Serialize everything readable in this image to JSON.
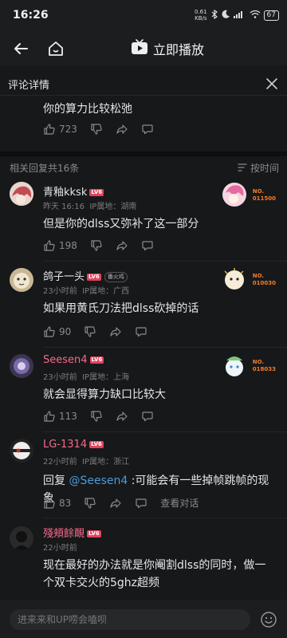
{
  "status": {
    "time": "16:26",
    "net_speed_value": "0.61",
    "net_speed_unit": "KB/s",
    "battery": "67"
  },
  "topbar": {
    "play_label": "立即播放"
  },
  "detail": {
    "title": "评论详情"
  },
  "main_comment": {
    "text": "你的算力比较松弛",
    "likes": "723"
  },
  "reply_section": {
    "count_label": "相关回复共16条",
    "sort_label": "按时间"
  },
  "replies": [
    {
      "username": "青釉kksk",
      "level": "LV6",
      "time": "昨天 16:16",
      "ip": "IP属地：湖南",
      "text": "但是你的dlss又弥补了这一部分",
      "likes": "198",
      "fan_no": "011500",
      "name_color": "#e6e6e6"
    },
    {
      "username": "鸽子一头",
      "level": "LV6",
      "tag": "番火鸡",
      "time": "23小时前",
      "ip": "IP属地：广西",
      "text": "如果用黄氏刀法把dlss砍掉的话",
      "likes": "90",
      "fan_no": "010030",
      "name_color": "#e6e6e6"
    },
    {
      "username": "Seesen4",
      "level": "LV6",
      "time": "23小时前",
      "ip": "IP属地：上海",
      "text": "就会显得算力缺口比较大",
      "likes": "113",
      "fan_no": "018033",
      "name_color": "#f36a8a"
    },
    {
      "username": "LG-1314",
      "level": "LV6",
      "time": "22小时前",
      "ip": "IP属地：浙江",
      "text_prefix": "回复 ",
      "mention": "@Seesen4",
      "text": " :可能会有一些掉帧跳帧的现象",
      "likes": "83",
      "view_dialog": "查看对话",
      "name_color": "#f36a8a"
    },
    {
      "username": "殘頬餘靦",
      "level": "LV6",
      "time": "22小时前",
      "text": "现在最好的办法就是你阉割dlss的同时，做一个双卡交火的5ghz超频",
      "name_color": "#f36a8a"
    }
  ],
  "fan_no_prefix": "NO.",
  "bottom": {
    "placeholder": "进来来和UP唠会嗑呗"
  },
  "colors": {
    "accent": "#e0445c",
    "mention": "#4a9bd9",
    "fan_badge": "#f07d2c"
  }
}
